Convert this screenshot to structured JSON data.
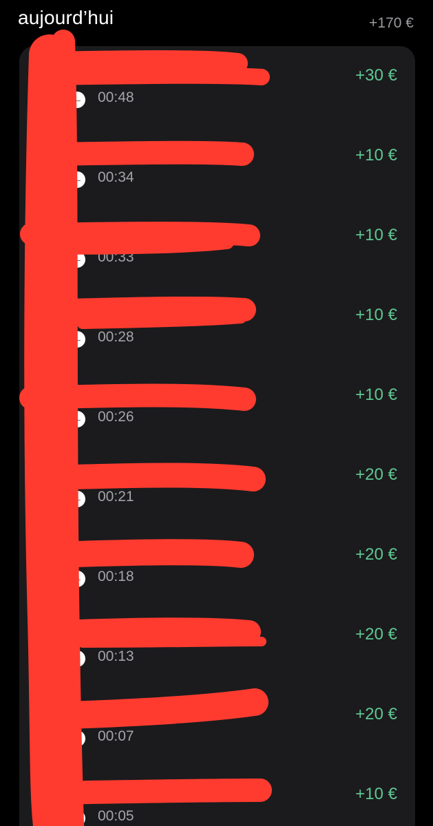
{
  "day": {
    "title": "aujourd’hui",
    "total": "+170 €"
  },
  "transactions": [
    {
      "time": "00:48",
      "amount": "+30 €"
    },
    {
      "time": "00:34",
      "amount": "+10 €"
    },
    {
      "time": "00:33",
      "amount": "+10 €"
    },
    {
      "time": "00:28",
      "amount": "+10 €"
    },
    {
      "time": "00:26",
      "amount": "+10 €"
    },
    {
      "time": "00:21",
      "amount": "+20 €"
    },
    {
      "time": "00:18",
      "amount": "+20 €"
    },
    {
      "time": "00:13",
      "amount": "+20 €"
    },
    {
      "time": "00:07",
      "amount": "+20 €"
    },
    {
      "time": "00:05",
      "amount": "+10 €"
    }
  ],
  "colors": {
    "background": "#000000",
    "card": "#1b1b1d",
    "amount_positive": "#5fc792",
    "secondary_text": "#a4a4aa",
    "redaction": "#ff3b30"
  },
  "icons": {
    "direction": "arrow-left-icon",
    "avatar": "avatar"
  }
}
